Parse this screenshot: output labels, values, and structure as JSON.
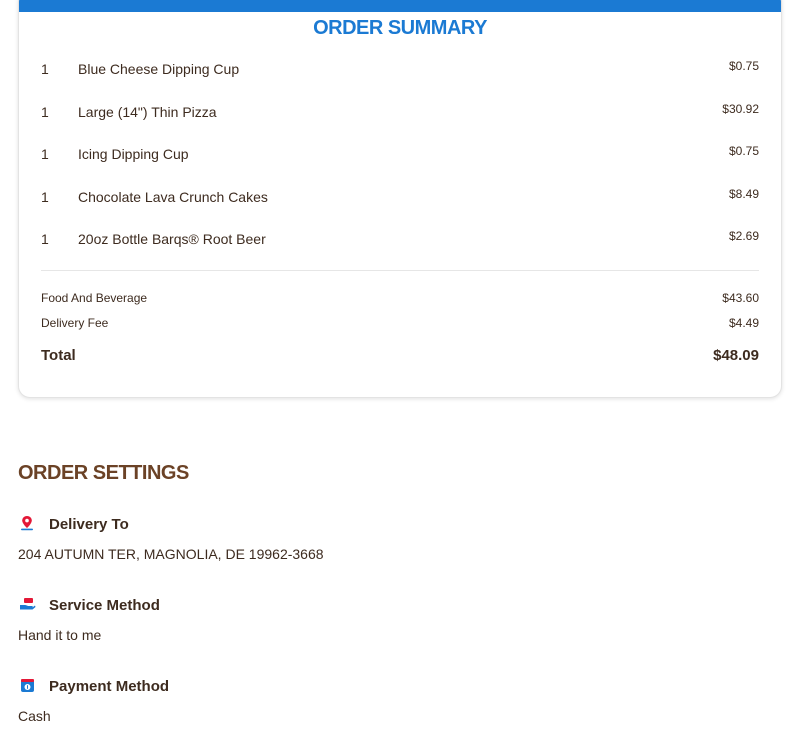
{
  "summary": {
    "title": "ORDER SUMMARY",
    "items": [
      {
        "qty": "1",
        "name": "Blue Cheese Dipping Cup",
        "price": "$0.75"
      },
      {
        "qty": "1",
        "name": "Large (14\") Thin Pizza",
        "price": "$30.92"
      },
      {
        "qty": "1",
        "name": "Icing Dipping Cup",
        "price": "$0.75"
      },
      {
        "qty": "1",
        "name": "Chocolate Lava Crunch Cakes",
        "price": "$8.49"
      },
      {
        "qty": "1",
        "name": "20oz Bottle Barqs® Root Beer",
        "price": "$2.69"
      }
    ],
    "food_label": "Food And Beverage",
    "food_value": "$43.60",
    "delivery_label": "Delivery Fee",
    "delivery_value": "$4.49",
    "total_label": "Total",
    "total_value": "$48.09"
  },
  "settings": {
    "title": "ORDER SETTINGS",
    "delivery_to": {
      "label": "Delivery To",
      "value": "204 AUTUMN TER, MAGNOLIA, DE 19962-3668",
      "icon": "map-pin-icon"
    },
    "service_method": {
      "label": "Service Method",
      "value": "Hand it to me",
      "icon": "hand-delivery-icon"
    },
    "payment_method": {
      "label": "Payment Method",
      "value": "Cash",
      "icon": "payment-icon"
    }
  },
  "colors": {
    "brand_blue": "#1b7ad3",
    "brand_red": "#e31837",
    "text_brown": "#3d2b1f",
    "heading_brown": "#6b4226"
  }
}
